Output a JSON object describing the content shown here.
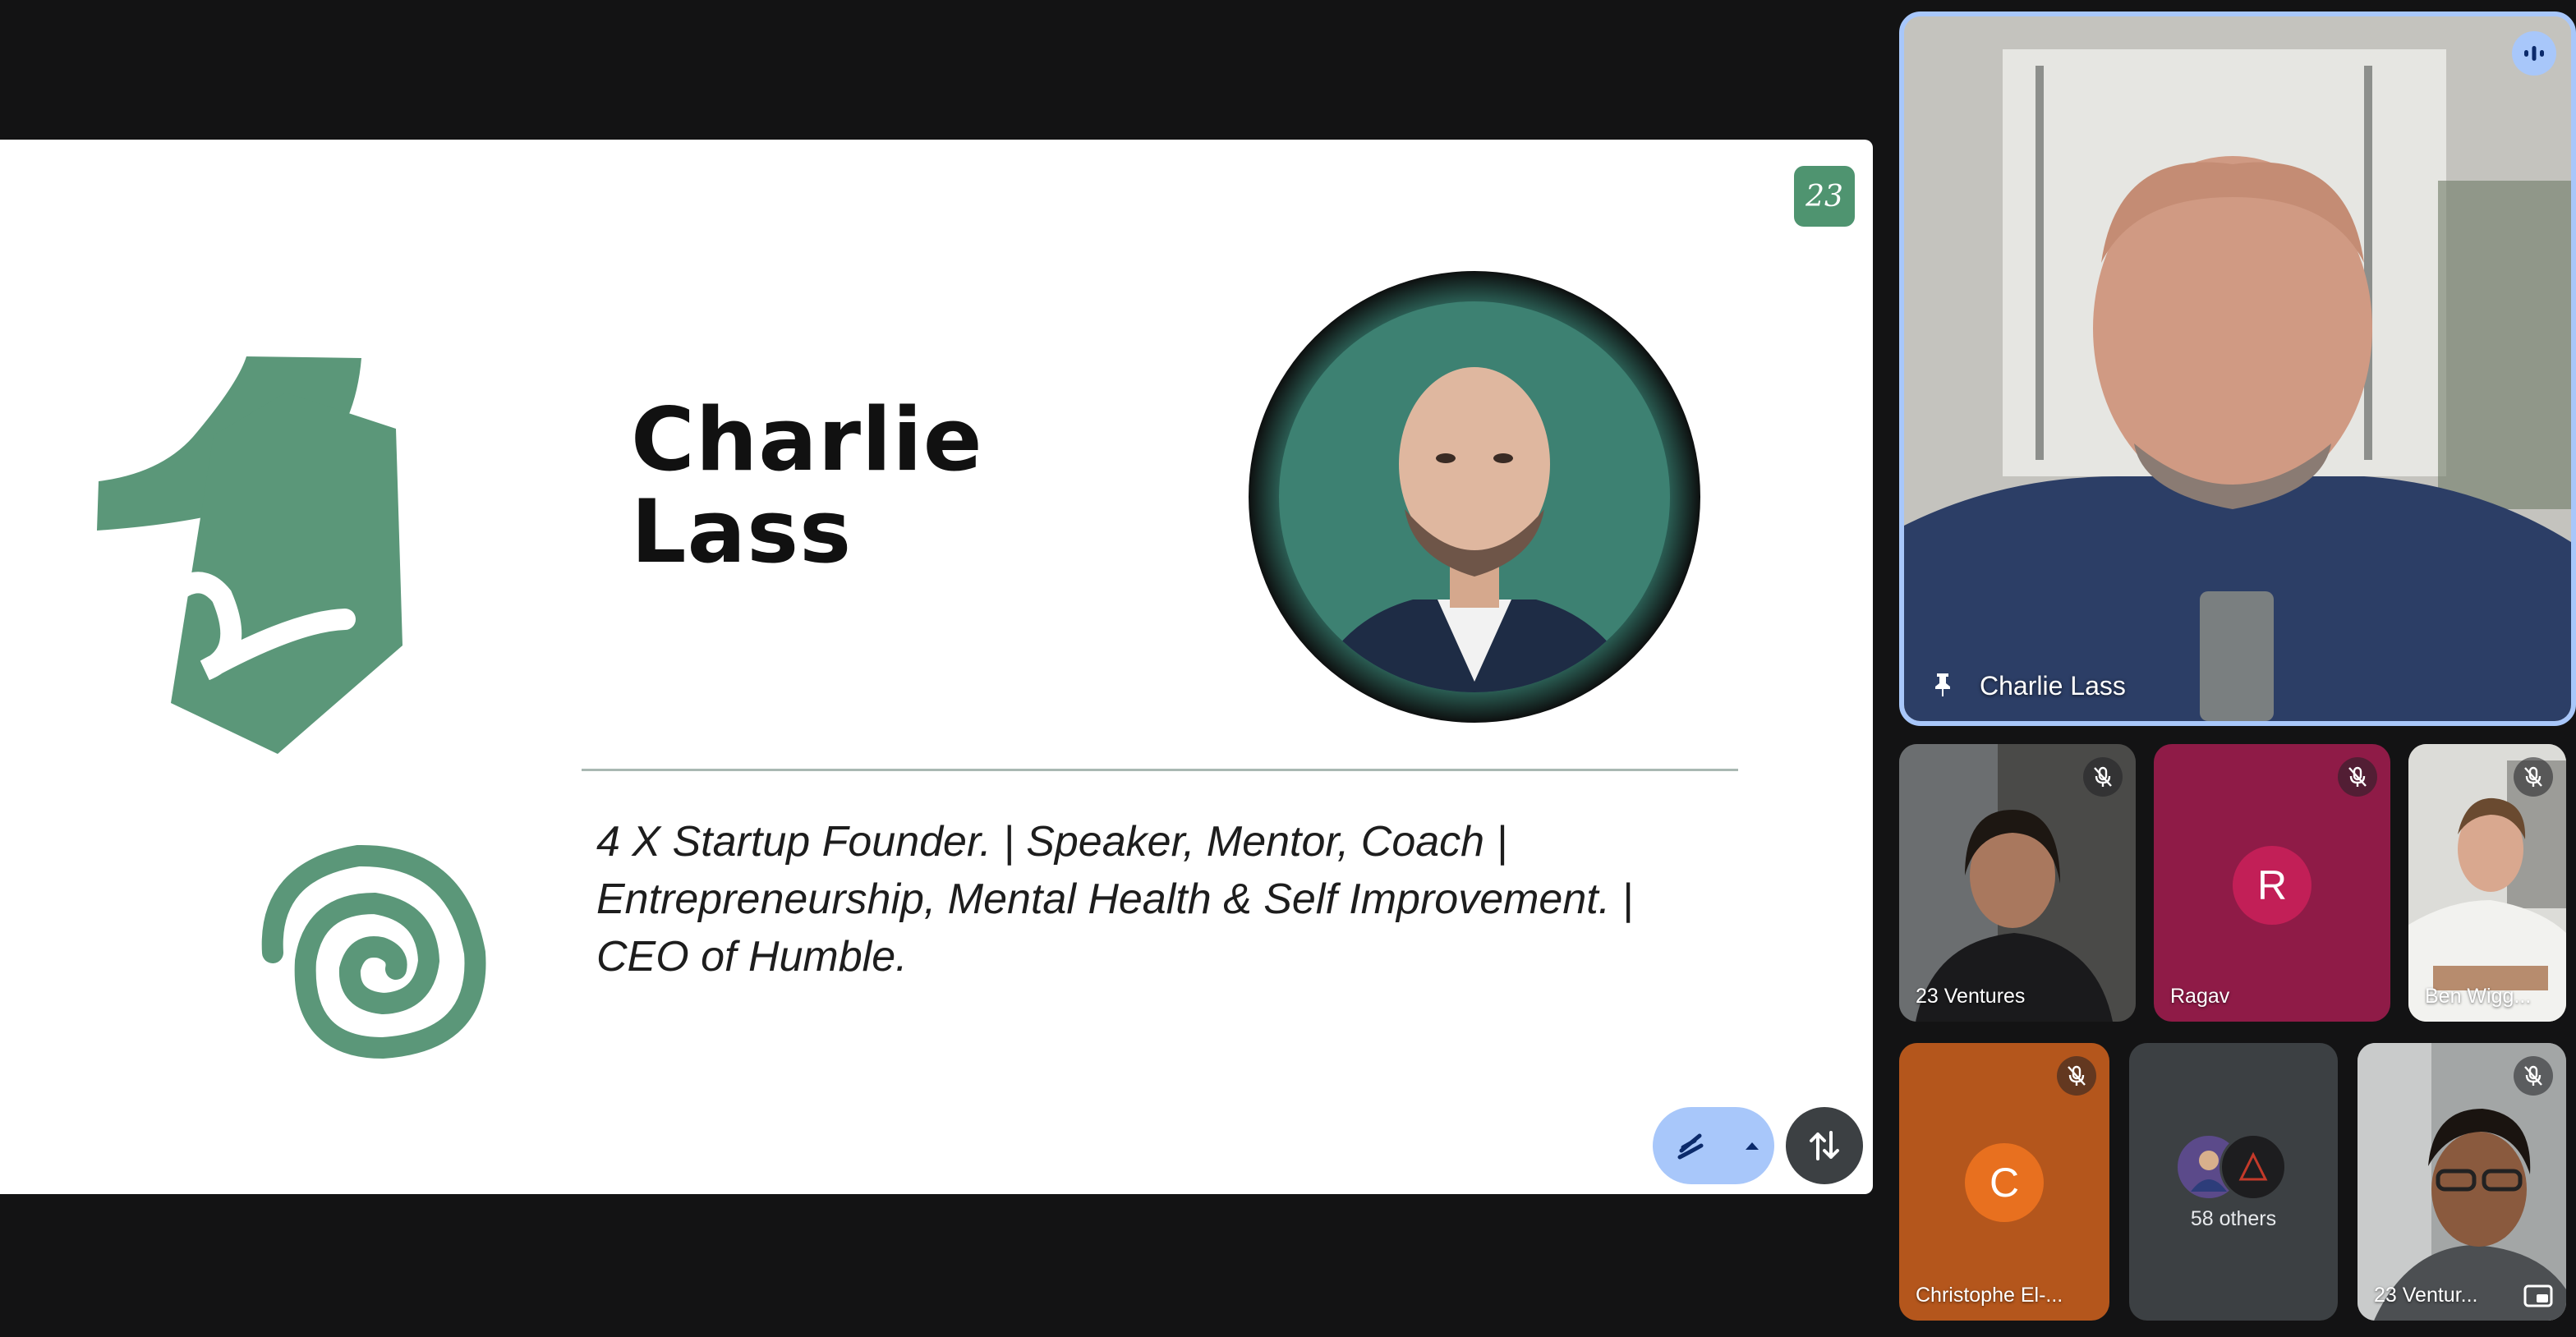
{
  "colors": {
    "background": "#131314",
    "slide_green": "#5b9779",
    "active_speaker_border": "#a8c7fa",
    "ragav_tile": "#8f1b47",
    "christophe_tile": "#b4561c"
  },
  "slide": {
    "logo_text": "23",
    "name_line1": "Charlie",
    "name_line2": "Lass",
    "bio": "4 X Startup Founder. | Speaker, Mentor, Coach | Entrepreneurship, Mental Health & Self Improvement. | CEO of Humble."
  },
  "slide_controls": {
    "annotate_icon": "pen-scribble-icon",
    "annotate_caret_icon": "caret-up-icon",
    "swap_icon": "swap-vertical-icon"
  },
  "speaker": {
    "name": "Charlie Lass",
    "indicator_icon": "audio-wave-icon",
    "pin_icon": "pin-icon"
  },
  "participants": [
    {
      "name": "23 Ventures",
      "muted": true
    },
    {
      "name": "Ragav",
      "initial": "R",
      "muted": true
    },
    {
      "name": "Ben Wigg...",
      "muted": true
    },
    {
      "name": "Christophe El-...",
      "initial": "C",
      "muted": true
    },
    {
      "name": "23 Ventur...",
      "muted": true
    }
  ],
  "others": {
    "label": "58 others"
  }
}
